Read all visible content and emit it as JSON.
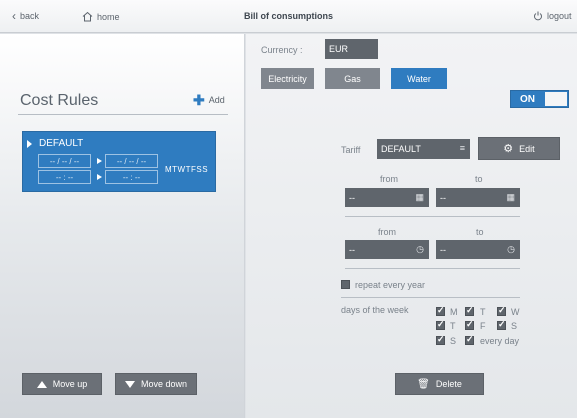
{
  "topbar": {
    "back_label": "back",
    "home_label": "home",
    "title": "Bill of consumptions",
    "logout_label": "logout"
  },
  "left": {
    "title": "Cost Rules",
    "add_label": "Add",
    "rule": {
      "name": "DEFAULT",
      "date_from": "-- / -- / --",
      "date_to": "-- / -- / --",
      "time_from": "-- : --",
      "time_to": "-- : --",
      "days": "MTWTFSS"
    },
    "move_up_label": "Move up",
    "move_down_label": "Move down"
  },
  "right": {
    "currency_label": "Currency :",
    "currency_value": "EUR",
    "tabs": [
      {
        "label": "Electricity",
        "active": false
      },
      {
        "label": "Gas",
        "active": false
      },
      {
        "label": "Water",
        "active": true
      }
    ],
    "toggle_label": "ON",
    "tariff_label": "Tariff",
    "tariff_value": "DEFAULT",
    "edit_label": "Edit",
    "date_from_label": "from",
    "date_to_label": "to",
    "date_from_value": "--",
    "date_to_value": "--",
    "time_from_label": "from",
    "time_to_label": "to",
    "time_from_value": "--",
    "time_to_value": "--",
    "repeat_label": "repeat every year",
    "days_label": "days of the week",
    "days": [
      {
        "label": "M",
        "checked": true
      },
      {
        "label": "T",
        "checked": true
      },
      {
        "label": "W",
        "checked": true
      },
      {
        "label": "T",
        "checked": true
      },
      {
        "label": "F",
        "checked": true
      },
      {
        "label": "S",
        "checked": true
      },
      {
        "label": "S",
        "checked": true
      },
      {
        "label": "every day",
        "checked": true
      }
    ],
    "delete_label": "Delete"
  },
  "colors": {
    "accent": "#2f7cc0",
    "button_dark": "#6b7077",
    "field_dark": "#5f656c"
  }
}
